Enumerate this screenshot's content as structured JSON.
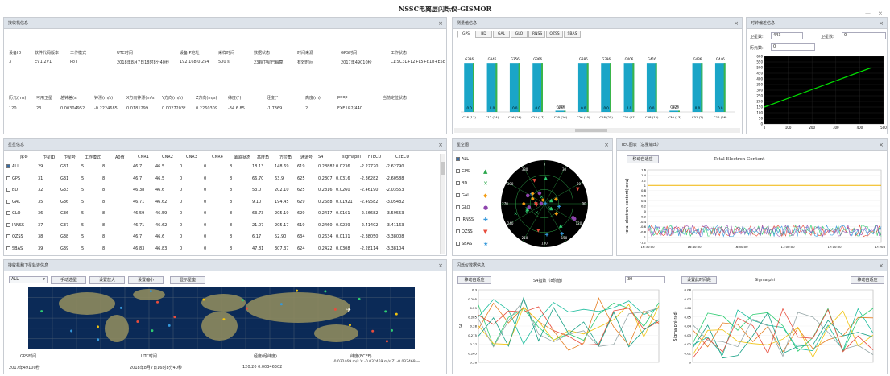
{
  "app": {
    "title": "NSSC电离层闪烁仪-GISMOR",
    "minimize": "—",
    "close": "×"
  },
  "device": {
    "title": "接收机信息",
    "close": "×",
    "top_headers": [
      "设备ID",
      "软件代码版本",
      "工作模式",
      "UTC时间",
      "设备IP地址",
      "采样时间",
      "数据状态",
      "时间来源",
      "GPS时间",
      "工作状态"
    ],
    "top_values": [
      "3",
      "EV1.2V1",
      "PoT",
      "2018年8月7日18时8分40秒",
      "192.168.0.254",
      "500 s",
      "23颗卫星已解算",
      "有效时间",
      "2017年49010秒",
      "L1:SC3L+L2+L5+E1b+E5b"
    ],
    "bottom_headers": [
      "历元(ms)",
      "可用卫星",
      "总钟差(s)",
      "钟漂(m/s)",
      "X方向钟漂(m/s)",
      "Y方向(m/s)",
      "Z方向(m/s)",
      "纬度(°)",
      "经度(°)",
      "高度(m)",
      "pdop",
      "当前定位状态"
    ],
    "bottom_values": [
      "120",
      "23",
      "0.00304952",
      "-0.2224685",
      "0.0181299",
      "0.0027203*",
      "0.2260309",
      "-34.6.85",
      "-1.7369",
      "2",
      "FXE1&2/440"
    ]
  },
  "signal": {
    "title": "测量值信息",
    "close": "×",
    "tabs": [
      "GPS",
      "BD",
      "GAL",
      "GLO",
      "IRNSS",
      "QZSS",
      "SBAS"
    ],
    "sats": [
      "G336",
      "G346",
      "G356",
      "G366",
      "G376",
      "G386",
      "G396",
      "G406",
      "G416",
      "G426",
      "G436",
      "G446"
    ],
    "x_labels": [
      "C18 (11)",
      "C12 (34)",
      "C16 (26)",
      "C23 (17)",
      "C25 (16)",
      "C26 (10)",
      "C18 (25)",
      "C20 (27)",
      "C28 (12)",
      "C30 (13)",
      "C31 (2)",
      "C12 (26)"
    ],
    "values": [
      0.78,
      0.78,
      0.78,
      0.78,
      0.02,
      0.78,
      0.78,
      0.78,
      0.78,
      0.02,
      0.78,
      0.78
    ],
    "bar_color": "#1aa5c7",
    "bar_color2": "#3ab54a"
  },
  "clock": {
    "title": "时钟偏差信息",
    "close": "×",
    "label_a": "卫星数:",
    "value_a": "443",
    "label_b": "卫星数:",
    "value_b": "0",
    "label_c": "历元数:",
    "value_c": "0",
    "chart_data": {
      "type": "line",
      "y_ticks": [
        "0",
        "50",
        "100",
        "150",
        "200",
        "250",
        "300",
        "350",
        "400",
        "450",
        "500",
        "550",
        "600"
      ],
      "x_ticks": [
        "0",
        "100",
        "200",
        "300",
        "400",
        "500"
      ],
      "series": [
        {
          "values": [
            [
              0,
              150
            ],
            [
              450,
              500
            ]
          ],
          "color": "#00e000"
        }
      ]
    }
  },
  "table": {
    "title": "星星信息",
    "close": "×",
    "headers": [
      "序号",
      "卫星ID",
      "卫星号",
      "工作模式",
      "A0值",
      "CNR1",
      "CNR2",
      "CNR3",
      "CNR4",
      "跟踪状态",
      "高度角",
      "方位角",
      "通道号",
      "S4",
      "sigmaphi",
      "FTECU",
      "C2ECU"
    ],
    "rows": [
      [
        "ALL",
        "29",
        "G31",
        "5",
        "8",
        "46.7",
        "46.5",
        "0",
        "0",
        "8",
        "18.13",
        "148.69",
        "619",
        "0.28882",
        "0.0236",
        "-2.22720",
        "-2.62790"
      ],
      [
        "GPS",
        "31",
        "G31",
        "5",
        "8",
        "46.7",
        "46.5",
        "0",
        "0",
        "8",
        "66.70",
        "63.9",
        "625",
        "0.2307",
        "0.0316",
        "-2.36282",
        "-2.60588"
      ],
      [
        "BD",
        "32",
        "G33",
        "5",
        "8",
        "46.38",
        "46.6",
        "0",
        "0",
        "8",
        "53.0",
        "202.10",
        "625",
        "0.2816",
        "0.0260",
        "-2.46190",
        "-2.03553"
      ],
      [
        "GAL",
        "35",
        "G36",
        "5",
        "8",
        "46.71",
        "46.62",
        "0",
        "0",
        "8",
        "9.10",
        "194.45",
        "629",
        "0.2688",
        "0.01921",
        "-2.49582",
        "-3.05482"
      ],
      [
        "GLO",
        "36",
        "G36",
        "5",
        "8",
        "46.59",
        "46.59",
        "0",
        "0",
        "8",
        "63.73",
        "205.19",
        "629",
        "0.2417",
        "0.0161",
        "-2.56682",
        "-3.59553"
      ],
      [
        "IRNSS",
        "37",
        "G37",
        "5",
        "8",
        "46.71",
        "46.62",
        "0",
        "0",
        "8",
        "21.07",
        "205.17",
        "619",
        "0.2460",
        "0.0239",
        "-2.41402",
        "-3.41163"
      ],
      [
        "QZSS",
        "38",
        "G38",
        "5",
        "8",
        "46.7",
        "46.6",
        "0",
        "0",
        "8",
        "6.17",
        "52.90",
        "634",
        "0.2634",
        "0.0131",
        "-2.38050",
        "-3.38008"
      ],
      [
        "SBAS",
        "39",
        "G39",
        "5",
        "8",
        "46.83",
        "46.83",
        "0",
        "0",
        "8",
        "47.81",
        "307.37",
        "624",
        "0.2422",
        "0.0308",
        "-2.28114",
        "-3.38104"
      ]
    ]
  },
  "skyplot": {
    "title": "星空图",
    "close": "×",
    "items": [
      "ALL",
      "GPS",
      "BD",
      "GAL",
      "GLO",
      "IRNSS",
      "QZSS",
      "SBAS"
    ],
    "colors": [
      "#666",
      "#2aa74b",
      "#2aa74b",
      "#f39c12",
      "#8e44ad",
      "#3498db",
      "#e74c3c",
      "#3498db"
    ],
    "az_labels": [
      "0",
      "30",
      "60",
      "90",
      "120",
      "150",
      "180",
      "210",
      "240",
      "270",
      "300",
      "330"
    ]
  },
  "tec": {
    "title": "TEC图表（总量输出）",
    "close": "×",
    "button": "移动自适应",
    "chart_title": "Total Electron Content",
    "ylabel": "total electron content(tecu)",
    "chart_data": {
      "type": "line",
      "y_ticks": [
        "1.6",
        "1.4",
        "1.2",
        "1",
        "0.8",
        "0.6",
        "0.4",
        "0.2",
        "0",
        "-0.2",
        "-0.4",
        "-0.6",
        "-0.8",
        "-1",
        "-1.2"
      ],
      "x_ticks": [
        "16:30:00",
        "16:40:00",
        "16:50:00",
        "17:00:00",
        "17:10:00",
        "17:20:00"
      ],
      "series": [
        {
          "name": "",
          "color": "#f0b400"
        },
        {
          "name": "",
          "color": "#2ecc71"
        },
        {
          "name": "",
          "color": "#e74c3c"
        },
        {
          "name": "",
          "color": "#3498db"
        },
        {
          "name": "",
          "color": "#9b59b6"
        }
      ]
    }
  },
  "map": {
    "title": "接收机和卫星轨迹信息",
    "close": "×",
    "select": "ALL",
    "buttons": [
      "手动选星",
      "设置放大",
      "设置缩小",
      "显示星座"
    ],
    "footer_headers": [
      "GPS时间",
      "UTC时间",
      "经度(经纬度)",
      "纬度(ECEF)"
    ],
    "footer_values": [
      "2017年49100秒",
      "2018年8月7日16时8分40秒",
      "120.20 0.00346302",
      "-0.032469 m/s Y: -0.032469 m/s Z: -0.032469 —"
    ]
  },
  "iono": {
    "title": "闪烁仪数据信息",
    "close": "×",
    "left_button": "移动自适应",
    "s4_label": "S4指数（8阶值）",
    "input_value": "30",
    "set_button": "设置此时间段",
    "sigma_title": "Sigma phi",
    "right_button": "移动自适应",
    "s4_chart": {
      "type": "line",
      "ylabel": "S4",
      "y_ticks": [
        "0.3",
        "0.295",
        "0.29",
        "0.285",
        "0.28",
        "0.275",
        "0.27",
        "0.265",
        "0.26"
      ]
    },
    "sigma_chart": {
      "type": "line",
      "ylabel": "Sigma phi(rad)",
      "y_ticks": [
        "0.08",
        "0.07",
        "0.06",
        "0.05",
        "0.04",
        "0.03",
        "0.02",
        "0.01",
        "0"
      ]
    }
  }
}
